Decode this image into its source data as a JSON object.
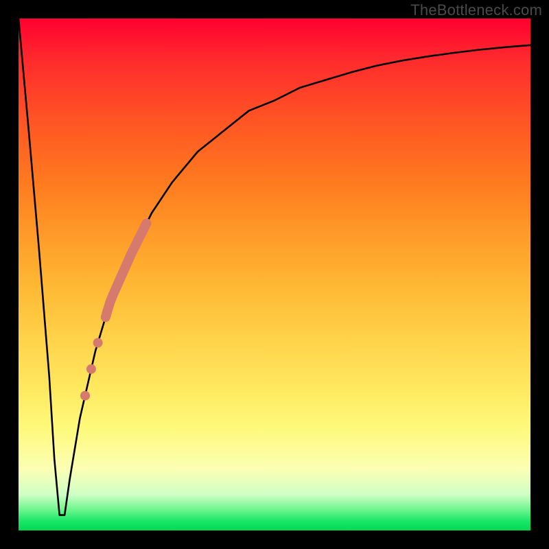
{
  "watermark": "TheBottleneck.com",
  "colors": {
    "frame": "#000000",
    "curve": "#000000",
    "highlight": "#d67a6e"
  },
  "chart_data": {
    "type": "line",
    "title": "",
    "xlabel": "",
    "ylabel": "",
    "xlim": [
      0,
      100
    ],
    "ylim": [
      0,
      100
    ],
    "grid": false,
    "legend": false,
    "comment": "Bottleneck-style curve: y is percentage (top=100, bottom=0). Sharp V dip near x≈8 to ~3%, then asymptotic rise toward ~95% on the right.",
    "series": [
      {
        "name": "bottleneck-curve",
        "x": [
          0,
          2,
          4,
          6,
          7,
          8,
          9,
          10,
          12,
          15,
          18,
          22,
          26,
          30,
          35,
          40,
          45,
          50,
          55,
          60,
          65,
          70,
          75,
          80,
          85,
          90,
          95,
          100
        ],
        "y": [
          100,
          78,
          55,
          30,
          14,
          3,
          3,
          10,
          22,
          35,
          45,
          54,
          62,
          68,
          74,
          78,
          82,
          84,
          86.5,
          88,
          89.5,
          90.8,
          91.8,
          92.6,
          93.3,
          93.9,
          94.4,
          94.8
        ]
      }
    ],
    "highlight_segment": {
      "comment": "Thick salmon segment overlaid on the curve roughly between x=17 and x=25 (pixel-approx values).",
      "x_start": 17,
      "x_end": 25
    },
    "highlight_dots": {
      "comment": "Three salmon dots on the curve just below the thick segment.",
      "x": [
        15.5,
        14.2,
        13.0
      ]
    }
  }
}
